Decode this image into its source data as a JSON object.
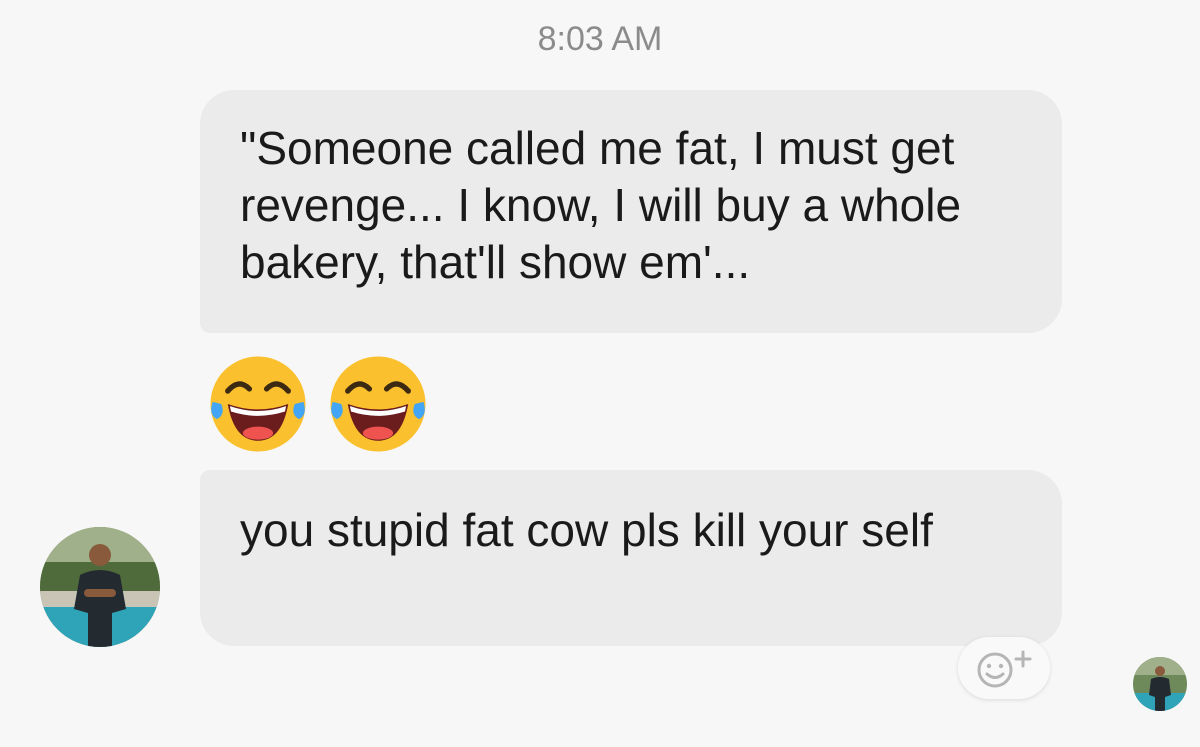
{
  "conversation": {
    "timestamp": "8:03 AM",
    "messages": [
      {
        "text": "\"Someone called me fat, I must get revenge... I know, I will buy a whole bakery, that'll show em'..."
      },
      {
        "text": "you stupid fat cow pls kill your self"
      }
    ],
    "emoji_reaction": {
      "icon": "face-with-tears-of-joy-icon",
      "count": 2
    },
    "react_button": {
      "icon": "smiley-add-icon"
    }
  },
  "colors": {
    "background": "#f7f7f7",
    "bubble": "#ebebeb",
    "timestamp": "#8b8b8b",
    "emoji_face": "#fbc02d"
  }
}
